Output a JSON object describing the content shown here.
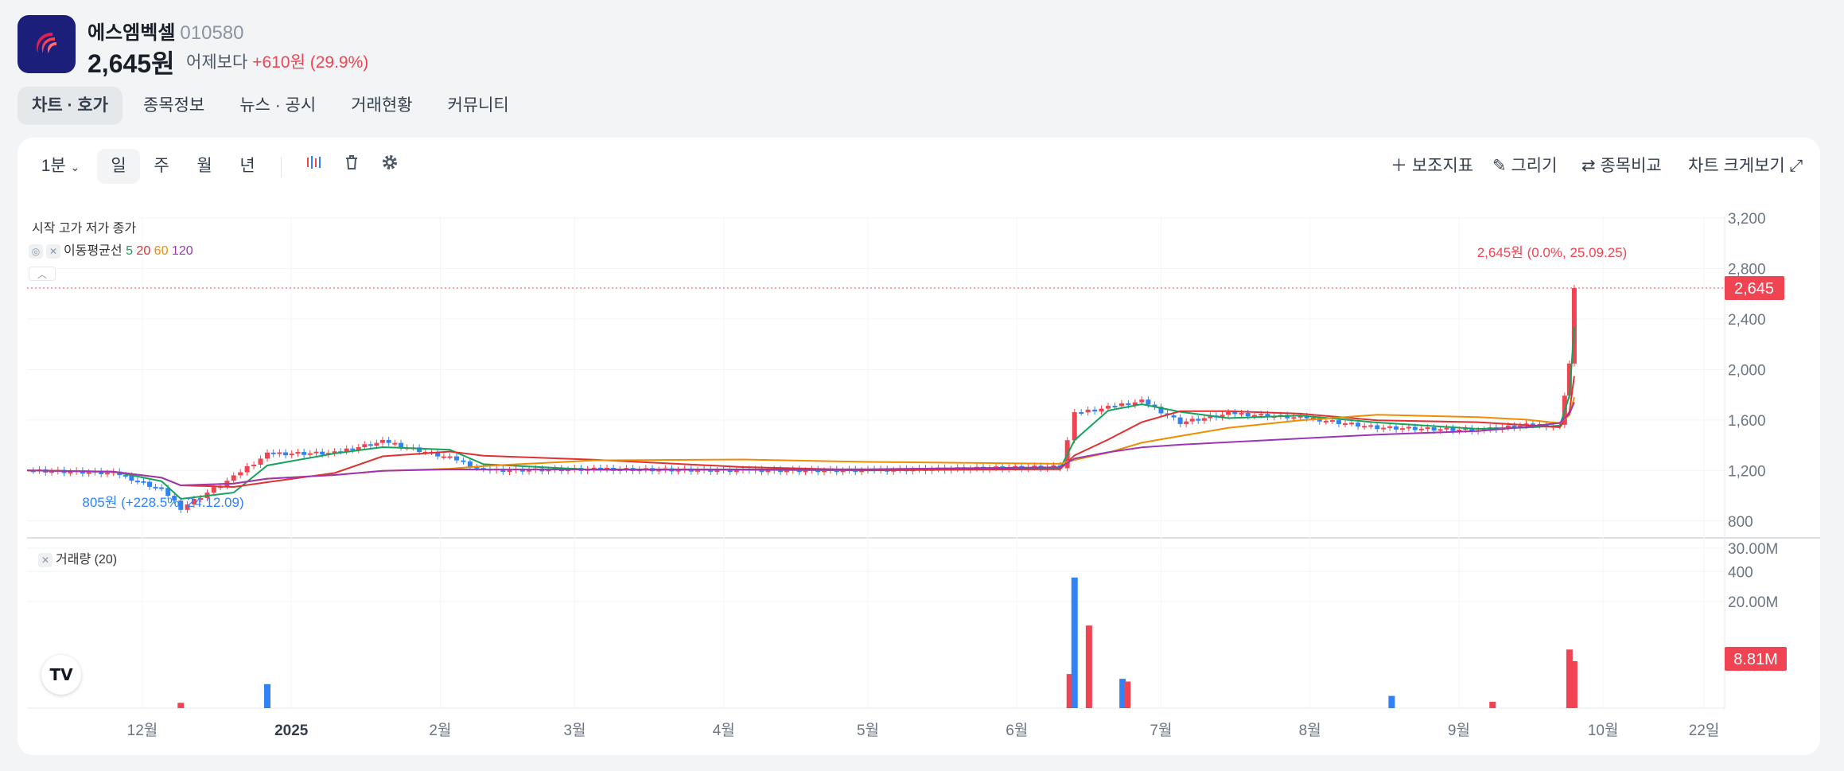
{
  "stock": {
    "name": "에스엠벡셀",
    "code": "010580",
    "price": "2,645원",
    "change_prefix": "어제보다",
    "change_value": "+610원 (29.9%)"
  },
  "tabs": [
    {
      "label": "차트 · 호가",
      "active": true
    },
    {
      "label": "종목정보",
      "active": false
    },
    {
      "label": "뉴스 · 공시",
      "active": false
    },
    {
      "label": "거래현황",
      "active": false
    },
    {
      "label": "커뮤니티",
      "active": false
    }
  ],
  "toolbar": {
    "interval": "1분",
    "periods": [
      "일",
      "주",
      "월",
      "년"
    ],
    "active_period": "일",
    "indicator_label": "보조지표",
    "draw_label": "그리기",
    "compare_label": "종목비교",
    "expand_label": "차트 크게보기"
  },
  "legend": {
    "ohlc": "시작 고가 저가 종가",
    "ma_label": "이동평균선",
    "ma_periods": [
      "5",
      "20",
      "60",
      "120"
    ],
    "volume_label": "거래량 (20)"
  },
  "annotations": {
    "high": "2,645원 (0.0%, 25.09.25)",
    "low": "805원 (+228.5%, 24.12.09)",
    "last_price_tag": "2,645",
    "last_volume_tag": "8.81M"
  },
  "colors": {
    "up": "#f04452",
    "down": "#3182f6",
    "ma5": "#12a35c",
    "ma20": "#e03131",
    "ma60": "#f08c00",
    "ma120": "#9c36b5",
    "volume_ma": "#12a35c"
  },
  "chart_data": {
    "type": "candlestick",
    "price_axis": {
      "ticks": [
        "3,200",
        "2,800",
        "2,400",
        "2,000",
        "1,600",
        "1,200",
        "800",
        "400"
      ],
      "range": [
        200,
        3200
      ]
    },
    "volume_axis": {
      "ticks": [
        "30.00M",
        "20.00M"
      ],
      "range": [
        0,
        30000000
      ]
    },
    "x_ticks": [
      "12월",
      "2025",
      "2월",
      "3월",
      "4월",
      "5월",
      "6월",
      "7월",
      "8월",
      "9월",
      "10월",
      "22일"
    ],
    "x_tick_dates": [
      "2024-12-01",
      "2025-01-01",
      "2025-02-01",
      "2025-03-01",
      "2025-04-01",
      "2025-05-01",
      "2025-06-01",
      "2025-07-01",
      "2025-08-01",
      "2025-09-01",
      "2025-10-01",
      "2025-10-22"
    ],
    "close_series": [
      {
        "date": "2024-11-07",
        "close": 1200
      },
      {
        "date": "2024-11-25",
        "close": 1180
      },
      {
        "date": "2024-12-05",
        "close": 1050
      },
      {
        "date": "2024-12-09",
        "close": 900
      },
      {
        "date": "2024-12-20",
        "close": 1150
      },
      {
        "date": "2024-12-27",
        "close": 1330
      },
      {
        "date": "2025-01-10",
        "close": 1340
      },
      {
        "date": "2025-01-20",
        "close": 1430
      },
      {
        "date": "2025-02-03",
        "close": 1300
      },
      {
        "date": "2025-02-10",
        "close": 1200
      },
      {
        "date": "2025-03-05",
        "close": 1210
      },
      {
        "date": "2025-04-05",
        "close": 1200
      },
      {
        "date": "2025-05-01",
        "close": 1200
      },
      {
        "date": "2025-06-10",
        "close": 1230
      },
      {
        "date": "2025-06-13",
        "close": 1650
      },
      {
        "date": "2025-06-20",
        "close": 1700
      },
      {
        "date": "2025-06-27",
        "close": 1750
      },
      {
        "date": "2025-07-05",
        "close": 1580
      },
      {
        "date": "2025-07-15",
        "close": 1650
      },
      {
        "date": "2025-07-30",
        "close": 1620
      },
      {
        "date": "2025-08-15",
        "close": 1540
      },
      {
        "date": "2025-09-05",
        "close": 1520
      },
      {
        "date": "2025-09-15",
        "close": 1560
      },
      {
        "date": "2025-09-22",
        "close": 1550
      },
      {
        "date": "2025-09-24",
        "close": 2035
      },
      {
        "date": "2025-09-25",
        "close": 2645
      }
    ],
    "volume_spikes": [
      {
        "date": "2024-12-09",
        "volume": 1000000
      },
      {
        "date": "2024-12-27",
        "volume": 4500000
      },
      {
        "date": "2025-06-12",
        "volume": 6400000
      },
      {
        "date": "2025-06-13",
        "volume": 24500000
      },
      {
        "date": "2025-06-16",
        "volume": 15500000
      },
      {
        "date": "2025-06-23",
        "volume": 5500000
      },
      {
        "date": "2025-06-24",
        "volume": 5000000
      },
      {
        "date": "2025-08-18",
        "volume": 2300000
      },
      {
        "date": "2025-09-08",
        "volume": 1200000
      },
      {
        "date": "2025-09-24",
        "volume": 11000000
      },
      {
        "date": "2025-09-25",
        "volume": 8810000
      }
    ],
    "moving_averages": [
      {
        "name": "5",
        "color": "#12a35c"
      },
      {
        "name": "20",
        "color": "#e03131"
      },
      {
        "name": "60",
        "color": "#f08c00"
      },
      {
        "name": "120",
        "color": "#9c36b5"
      }
    ],
    "legend_placement": "top-left",
    "grid": true
  }
}
